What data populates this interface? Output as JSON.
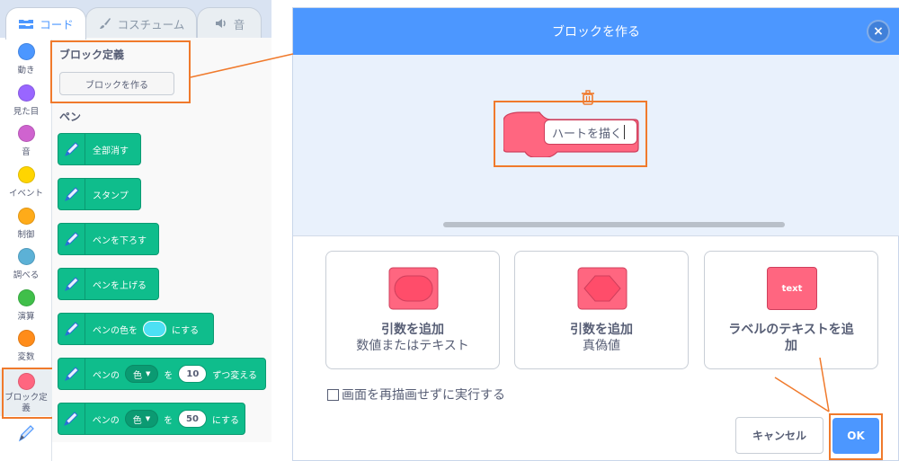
{
  "tabs": [
    {
      "label": "コード",
      "icon": "code-icon"
    },
    {
      "label": "コスチューム",
      "icon": "brush-icon"
    },
    {
      "label": "音",
      "icon": "speaker-icon"
    }
  ],
  "categories": [
    {
      "label": "動き",
      "color": "#4c97ff"
    },
    {
      "label": "見た目",
      "color": "#9966ff"
    },
    {
      "label": "音",
      "color": "#cf63cf"
    },
    {
      "label": "イベント",
      "color": "#ffd500"
    },
    {
      "label": "制御",
      "color": "#ffab19"
    },
    {
      "label": "調べる",
      "color": "#5cb1d6"
    },
    {
      "label": "演算",
      "color": "#40bf4a"
    },
    {
      "label": "変数",
      "color": "#ff8c1a"
    },
    {
      "label": "ブロック定\n義",
      "color": "#ff6680"
    }
  ],
  "palette": {
    "my_blocks_title": "ブロック定義",
    "make_block_button": "ブロックを作る",
    "pen_title": "ペン",
    "blocks": [
      {
        "text": "全部消す"
      },
      {
        "text": "スタンプ"
      },
      {
        "text": "ペンを下ろす"
      },
      {
        "text": "ペンを上げる"
      },
      {
        "text": "ペンの色を",
        "text2": "にする"
      },
      {
        "text": "ペンの",
        "dropdown": "色",
        "text2": "を",
        "value": "10",
        "text3": "ずつ変える"
      },
      {
        "text": "ペンの",
        "dropdown": "色",
        "text2": "を",
        "value": "50",
        "text3": "にする"
      }
    ]
  },
  "modal": {
    "title": "ブロックを作る",
    "close": "×",
    "block_name": "ハートを描く",
    "options": [
      {
        "line1": "引数を追加",
        "line2": "数値またはテキスト",
        "icon": "number-text-input-icon"
      },
      {
        "line1": "引数を追加",
        "line2": "真偽値",
        "icon": "boolean-input-icon"
      },
      {
        "line1": "ラベルのテキストを追",
        "line2": "加",
        "icon_text": "text",
        "icon": "label-text-icon"
      }
    ],
    "checkbox_label": "画面を再描画せずに実行する",
    "checkbox_checked": false,
    "cancel": "キャンセル",
    "ok": "OK"
  },
  "colors": {
    "accent": "#4c97ff",
    "pen_green": "#0fbd8c",
    "my_blocks_pink": "#ff6680",
    "highlight": "#f07a2c"
  }
}
